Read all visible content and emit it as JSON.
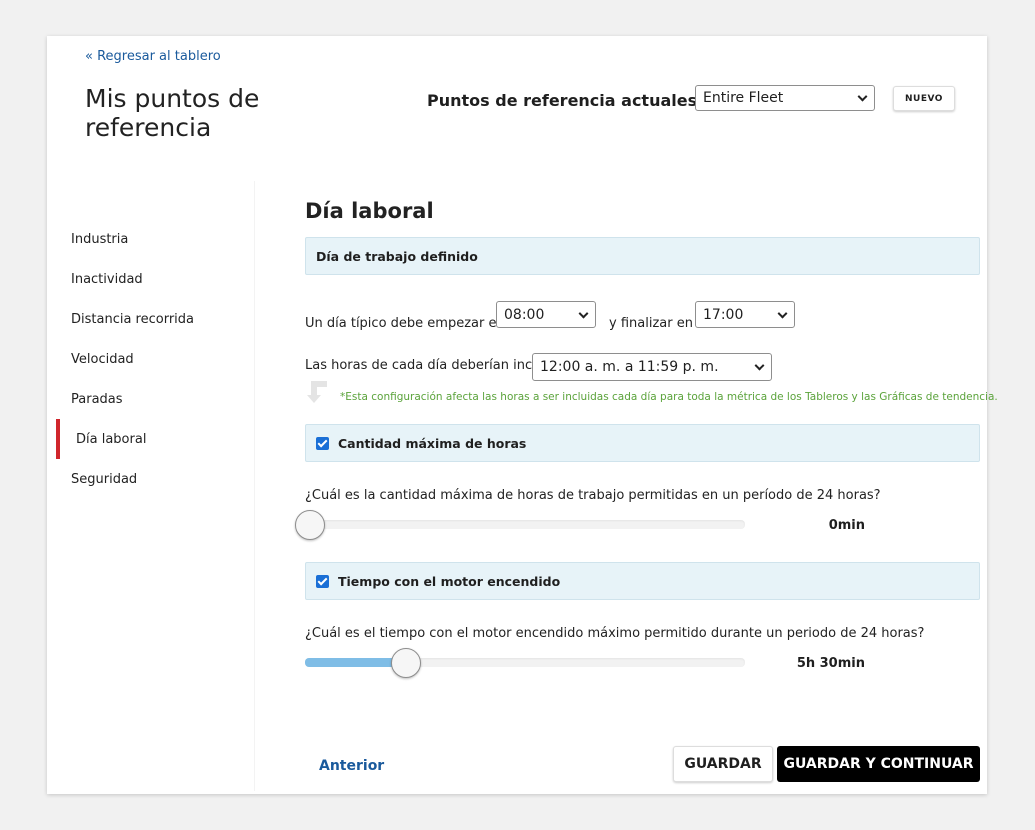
{
  "header": {
    "back_link": "« Regresar al tablero",
    "title": "Mis puntos de referencia",
    "current_label": "Puntos de referencia actuales :",
    "fleet_select": "Entire Fleet",
    "new_button": "NUEVO"
  },
  "sidebar": {
    "items": [
      {
        "label": "Industria"
      },
      {
        "label": "Inactividad"
      },
      {
        "label": "Distancia recorrida"
      },
      {
        "label": "Velocidad"
      },
      {
        "label": "Paradas"
      },
      {
        "label": "Día laboral",
        "active": true
      },
      {
        "label": "Seguridad"
      }
    ]
  },
  "main": {
    "section_title": "Día laboral",
    "workday_band": "Día de trabajo definido",
    "start_label": "Un día típico debe empezar en",
    "start_value": "08:00",
    "end_label": "y finalizar en",
    "end_value": "17:00",
    "hours_label": "Las horas de cada día deberían incluir",
    "hours_value": "12:00 a. m. a 11:59 p. m.",
    "note": "*Esta configuración afecta las horas a ser incluidas cada día para toda la métrica de los Tableros y las Gráficas de tendencia.",
    "max_hours": {
      "checkbox_label": "Cantidad máxima de horas",
      "checked": true,
      "question": "¿Cuál es la cantidad máxima de horas de trabajo permitidas en un período de 24 horas?",
      "value_text": "0min",
      "level": 0.0
    },
    "engine_time": {
      "checkbox_label": "Tiempo con el motor encendido",
      "checked": true,
      "question": "¿Cuál es el tiempo con el motor encendido máximo permitido durante un periodo de 24 horas?",
      "value_text": "5h 30min",
      "level": 0.23
    }
  },
  "footer": {
    "prev_link": "Anterior",
    "save_button": "GUARDAR",
    "save_continue_button": "GUARDAR Y CONTINUAR"
  },
  "colors": {
    "accent": "#d0262c",
    "link": "#1a5a9c",
    "band_bg": "#e7f3f8",
    "note": "#5ba33b",
    "slider_fill": "#7fbde6"
  }
}
